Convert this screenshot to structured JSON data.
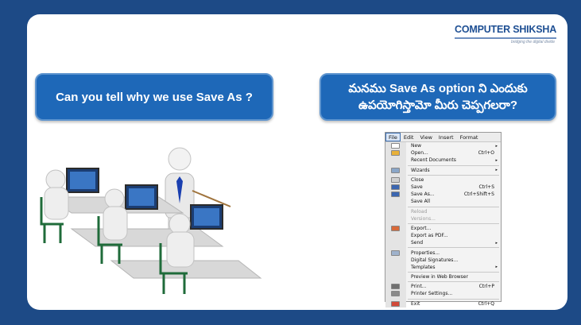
{
  "logo": {
    "text": "COMPUTER SHIKSHA",
    "tagline": "bridging the digital divide"
  },
  "question_english": "Can you tell why we use Save As ?",
  "question_telugu": "మనము Save As option ని ఎందుకు ఉపయోగిస్తామో మీరు చెప్పగలరా?",
  "menu": {
    "menubar": [
      "File",
      "Edit",
      "View",
      "Insert",
      "Format"
    ],
    "items": [
      {
        "label": "New",
        "shortcut": "",
        "submenu": true,
        "icon": "new-doc-icon"
      },
      {
        "label": "Open...",
        "shortcut": "Ctrl+O",
        "submenu": false,
        "icon": "open-folder-icon"
      },
      {
        "label": "Recent Documents",
        "shortcut": "",
        "submenu": true,
        "icon": ""
      },
      {
        "sep": true
      },
      {
        "label": "Wizards",
        "shortcut": "",
        "submenu": true,
        "icon": "wizard-icon"
      },
      {
        "sep": true
      },
      {
        "label": "Close",
        "shortcut": "",
        "submenu": false,
        "icon": "close-doc-icon"
      },
      {
        "label": "Save",
        "shortcut": "Ctrl+S",
        "submenu": false,
        "icon": "save-icon"
      },
      {
        "label": "Save As...",
        "shortcut": "Ctrl+Shift+S",
        "submenu": false,
        "icon": "save-as-icon"
      },
      {
        "label": "Save All",
        "shortcut": "",
        "submenu": false,
        "icon": ""
      },
      {
        "sep": true
      },
      {
        "label": "Reload",
        "shortcut": "",
        "submenu": false,
        "icon": "",
        "disabled": true
      },
      {
        "label": "Versions...",
        "shortcut": "",
        "submenu": false,
        "icon": "",
        "disabled": true
      },
      {
        "sep": true
      },
      {
        "label": "Export...",
        "shortcut": "",
        "submenu": false,
        "icon": "export-icon"
      },
      {
        "label": "Export as PDF...",
        "shortcut": "",
        "submenu": false,
        "icon": ""
      },
      {
        "label": "Send",
        "shortcut": "",
        "submenu": true,
        "icon": ""
      },
      {
        "sep": true
      },
      {
        "label": "Properties...",
        "shortcut": "",
        "submenu": false,
        "icon": "properties-icon"
      },
      {
        "label": "Digital Signatures...",
        "shortcut": "",
        "submenu": false,
        "icon": ""
      },
      {
        "label": "Templates",
        "shortcut": "",
        "submenu": true,
        "icon": ""
      },
      {
        "sep": true
      },
      {
        "label": "Preview in Web Browser",
        "shortcut": "",
        "submenu": false,
        "icon": ""
      },
      {
        "sep": true
      },
      {
        "label": "Print...",
        "shortcut": "Ctrl+P",
        "submenu": false,
        "icon": "print-icon"
      },
      {
        "label": "Printer Settings...",
        "shortcut": "",
        "submenu": false,
        "icon": "printer-settings-icon"
      },
      {
        "sep": true
      },
      {
        "label": "Exit",
        "shortcut": "Ctrl+Q",
        "submenu": false,
        "icon": "exit-icon"
      }
    ]
  },
  "colors": {
    "background": "#1d4a86",
    "callout": "#1e68b8",
    "logo": "#1e4f93"
  }
}
